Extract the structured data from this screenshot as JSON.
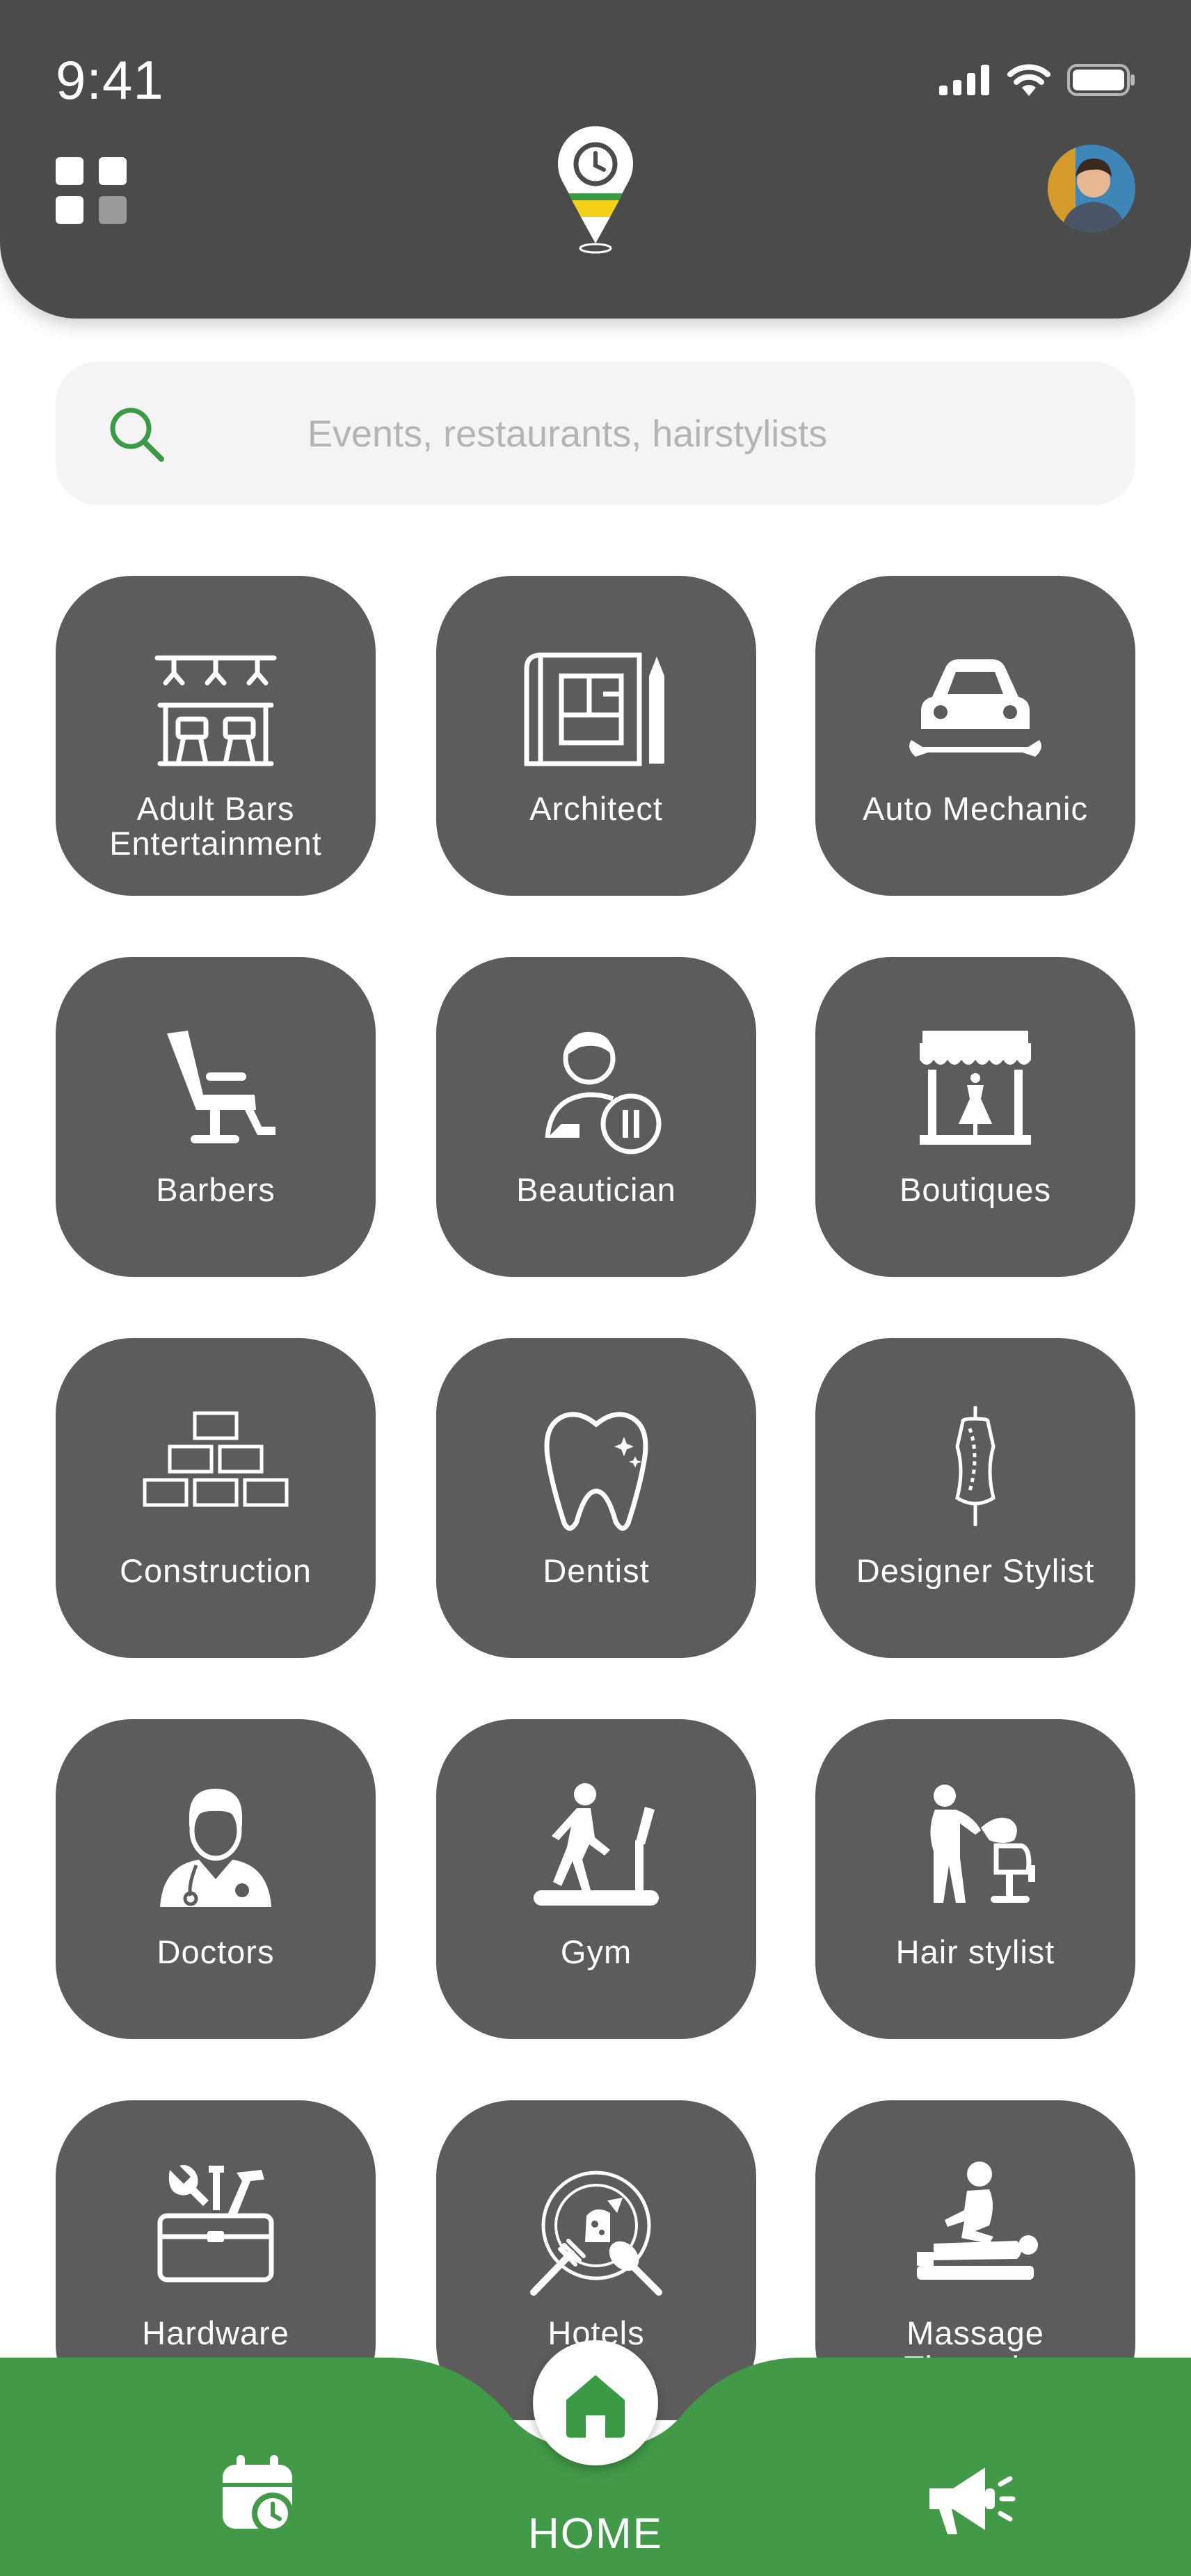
{
  "status_bar": {
    "time": "9:41"
  },
  "header": {
    "menu_icon": "grid-menu-icon",
    "logo_icon": "location-pin-clock-logo",
    "avatar_icon": "user-avatar"
  },
  "search": {
    "placeholder": "Events, restaurants, hairstylists",
    "value": ""
  },
  "categories": [
    {
      "label": "Adult Bars\nEntertainment",
      "icon": "bar-stools-icon"
    },
    {
      "label": "Architect",
      "icon": "blueprint-icon"
    },
    {
      "label": "Auto Mechanic",
      "icon": "car-wrench-icon"
    },
    {
      "label": "Barbers",
      "icon": "barber-chair-icon"
    },
    {
      "label": "Beautician",
      "icon": "beautician-icon"
    },
    {
      "label": "Boutiques",
      "icon": "storefront-dress-icon"
    },
    {
      "label": "Construction",
      "icon": "bricks-icon"
    },
    {
      "label": "Dentist",
      "icon": "tooth-icon"
    },
    {
      "label": "Designer Stylist",
      "icon": "mannequin-icon"
    },
    {
      "label": "Doctors",
      "icon": "doctor-icon"
    },
    {
      "label": "Gym",
      "icon": "treadmill-icon"
    },
    {
      "label": "Hair stylist",
      "icon": "hair-stylist-icon"
    },
    {
      "label": "Hardware",
      "icon": "toolbox-icon"
    },
    {
      "label": "Hotels",
      "icon": "plate-fork-icon"
    },
    {
      "label": "Massage\nTherapist",
      "icon": "massage-icon"
    }
  ],
  "bottom_nav": {
    "home_label": "HOME",
    "left_icon": "calendar-clock-icon",
    "right_icon": "megaphone-icon"
  },
  "colors": {
    "header_bg": "#4b4b4b",
    "tile_bg": "#5c5c5c",
    "accent_green": "#429a48"
  }
}
